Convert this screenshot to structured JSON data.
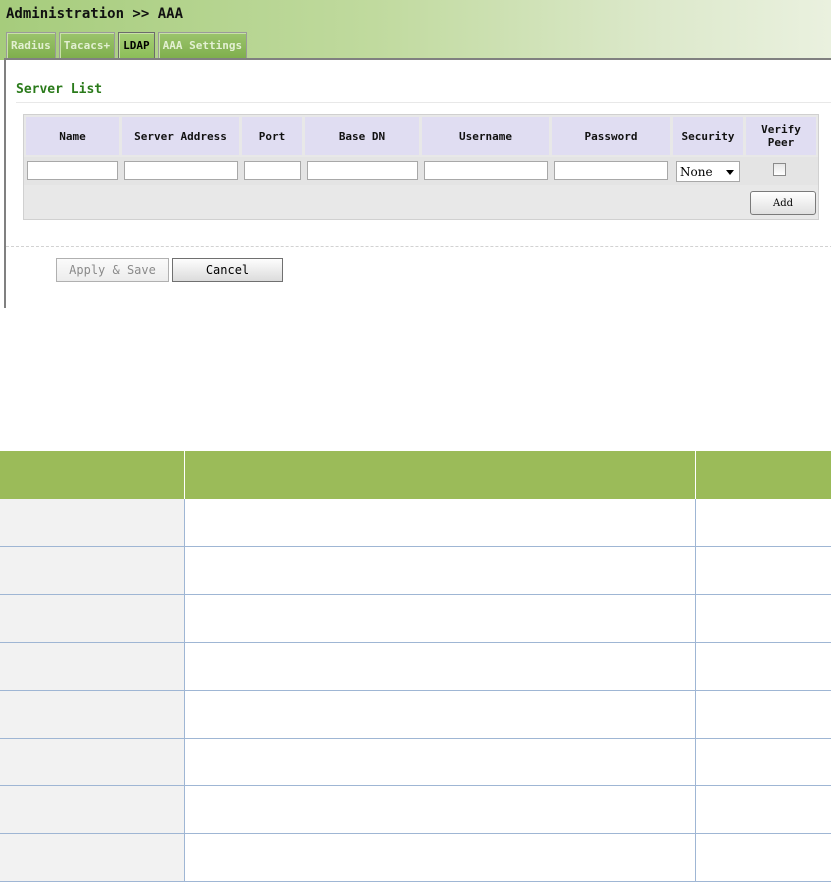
{
  "header": {
    "breadcrumb": "Administration >> AAA",
    "tabs": [
      {
        "label": "Radius",
        "active": false
      },
      {
        "label": "Tacacs+",
        "active": false
      },
      {
        "label": "LDAP",
        "active": true
      },
      {
        "label": "AAA Settings",
        "active": false
      }
    ]
  },
  "server_list": {
    "title": "Server List",
    "columns": [
      "Name",
      "Server Address",
      "Port",
      "Base DN",
      "Username",
      "Password",
      "Security",
      "Verify\nPeer"
    ],
    "new_row": {
      "name": "",
      "server_address": "",
      "port": "",
      "base_dn": "",
      "username": "",
      "password": "",
      "security": "None",
      "verify_peer": false
    },
    "add_label": "Add"
  },
  "actions": {
    "apply_label": "Apply & Save",
    "cancel_label": "Cancel"
  },
  "lower_table": {
    "headers": [
      "",
      "",
      ""
    ],
    "rows": [
      [
        "",
        "",
        ""
      ],
      [
        "",
        "",
        ""
      ],
      [
        "",
        "",
        ""
      ],
      [
        "",
        "",
        ""
      ],
      [
        "",
        "",
        ""
      ],
      [
        "",
        "",
        ""
      ],
      [
        "",
        "",
        ""
      ],
      [
        "",
        "",
        ""
      ]
    ]
  },
  "colors": {
    "header_gradient_start": "#a6cc7c",
    "tab_green": "#8cbd59",
    "section_title": "#2a7a1a",
    "table_header_bg": "#e0ddf2",
    "grid_header": "#9bbb59",
    "grid_border": "#9fb6d4",
    "grid_first_col": "#f2f2f2"
  }
}
